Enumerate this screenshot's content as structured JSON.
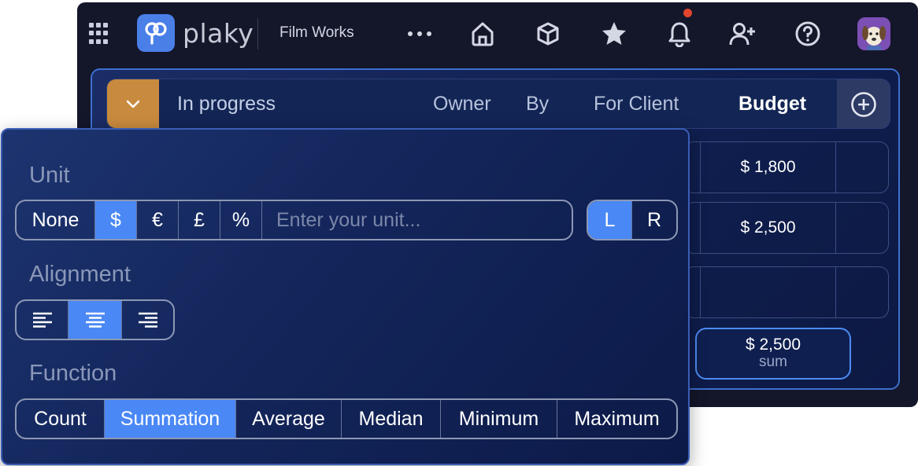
{
  "topbar": {
    "logo_text": "plaky",
    "workspace": "Film Works",
    "icons": [
      "apps-grid-icon",
      "more-icon",
      "home-icon",
      "cube-icon",
      "star-icon",
      "bell-icon",
      "add-user-icon",
      "help-icon"
    ],
    "notification_dot_color": "#e2452d"
  },
  "board": {
    "group_title": "In progress",
    "group_color": "#c88a3e",
    "columns": [
      "Owner",
      "By",
      "For Client",
      "Budget"
    ],
    "active_column": "Budget",
    "rows": [
      "$ 1,800",
      "$ 2,500",
      ""
    ],
    "summary": {
      "value": "$ 2,500",
      "label": "sum"
    }
  },
  "panel": {
    "unit": {
      "label": "Unit",
      "options": [
        "None",
        "$",
        "€",
        "£",
        "%"
      ],
      "selected": "$",
      "input_placeholder": "Enter your unit...",
      "position_options": [
        "L",
        "R"
      ],
      "position_selected": "L"
    },
    "alignment": {
      "label": "Alignment",
      "options": [
        "left",
        "center",
        "right"
      ],
      "selected": "center"
    },
    "function": {
      "label": "Function",
      "options": [
        "Count",
        "Summation",
        "Average",
        "Median",
        "Minimum",
        "Maximum"
      ],
      "selected": "Summation"
    }
  },
  "colors": {
    "accent": "#4a88f5",
    "app_bg": "#14162a",
    "panel_bg": "#13255a"
  }
}
